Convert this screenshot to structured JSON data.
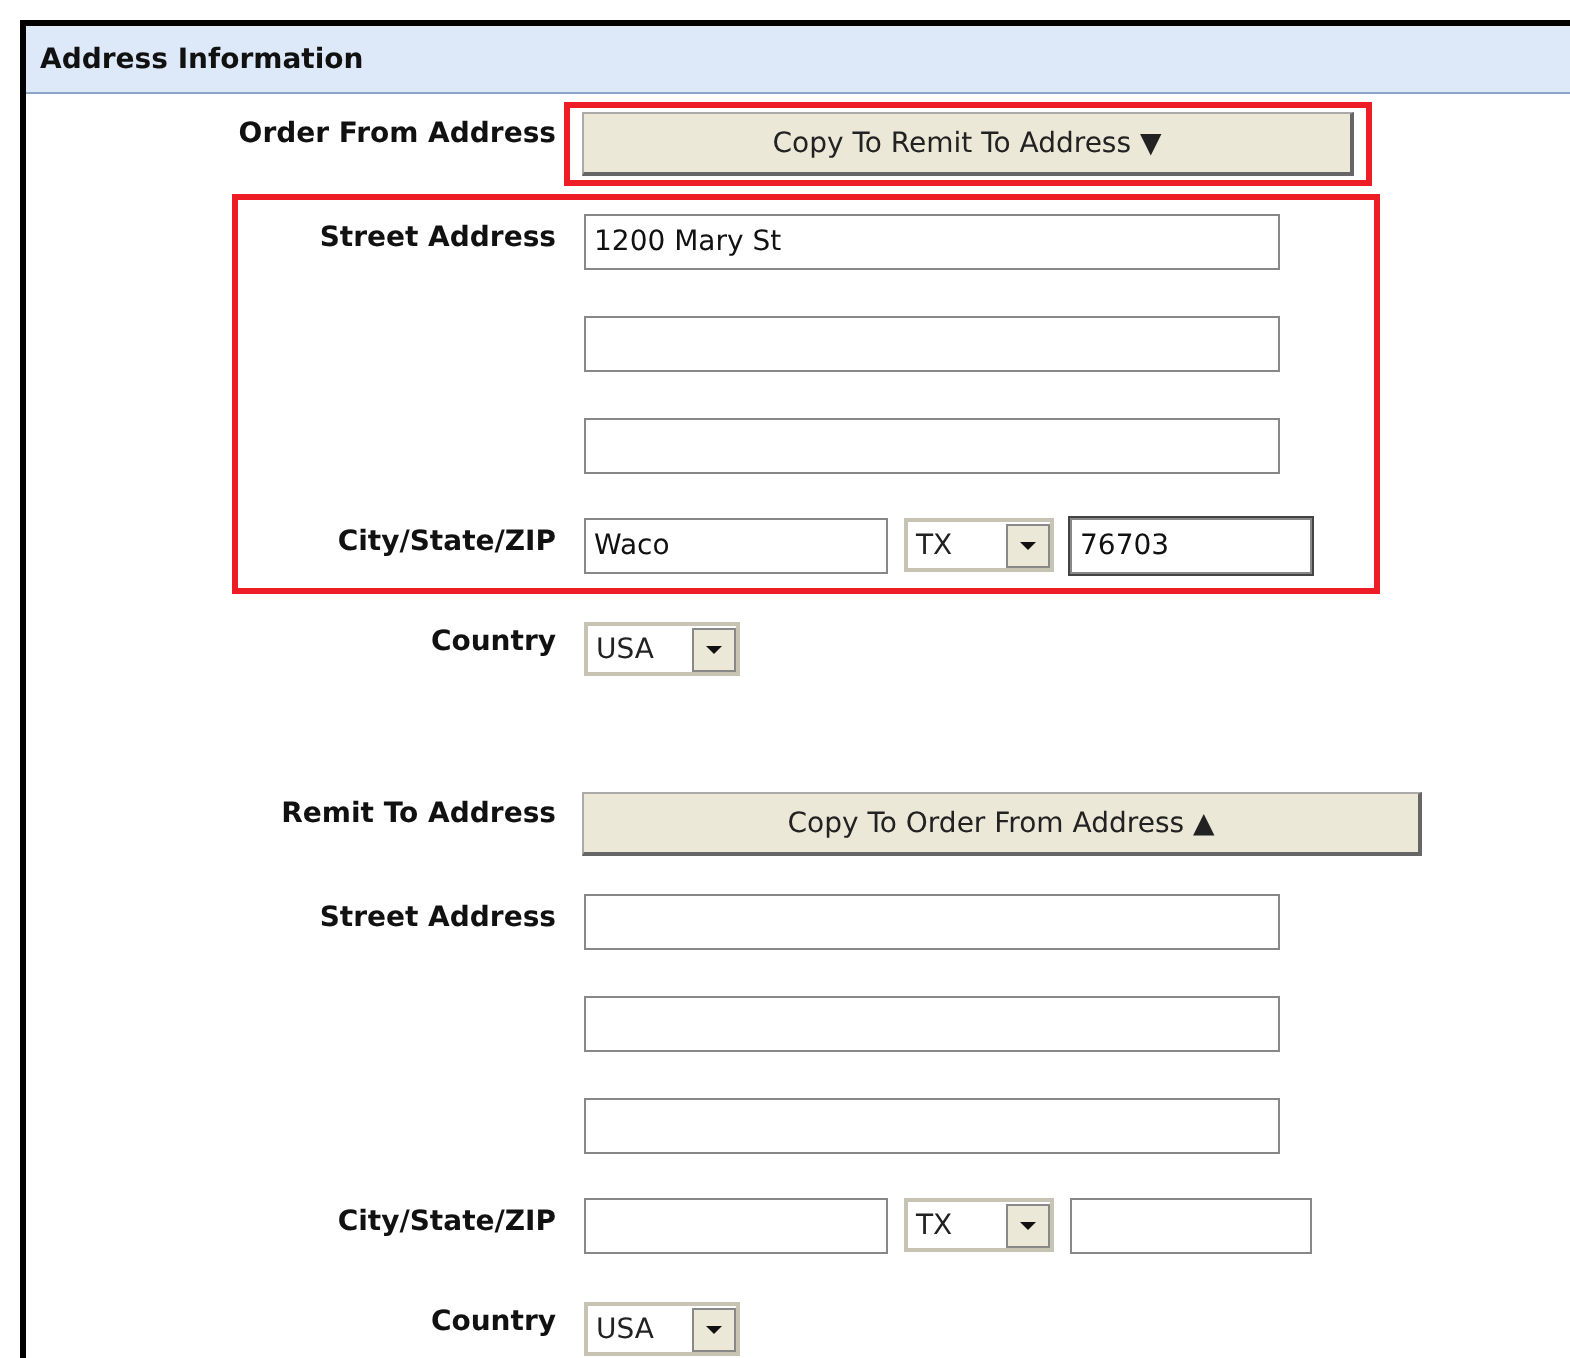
{
  "section_title": "Address Information",
  "addresses": [
    {
      "label": "Order From Address",
      "copy_button": {
        "label": "Copy To Remit To Address ▼",
        "highlighted": true
      },
      "fields_highlighted": true,
      "street_label": "Street Address",
      "street_fields": [
        {
          "kind": "text",
          "value": "1200 Mary St"
        },
        {
          "kind": "text"
        },
        {
          "kind": "text"
        }
      ],
      "city_label": "City/State/ZIP",
      "city": {
        "kind": "text",
        "value": "Waco"
      },
      "state": "TX",
      "zip": {
        "kind": "text",
        "value": "76703",
        "focused": true
      },
      "country_label": "Country",
      "country": "USA"
    },
    {
      "label": "Remit To Address",
      "copy_button": {
        "label": "Copy To Order From Address ▲",
        "highlighted": false
      },
      "fields_highlighted": false,
      "street_label": "Street Address",
      "street_fields": [
        {
          "kind": "text"
        },
        {
          "kind": "text"
        },
        {
          "kind": "text"
        }
      ],
      "city_label": "City/State/ZIP",
      "city": {
        "kind": "text"
      },
      "state": "TX",
      "zip": {
        "kind": "text",
        "focused": false
      },
      "country_label": "Country",
      "country": "USA"
    }
  ]
}
